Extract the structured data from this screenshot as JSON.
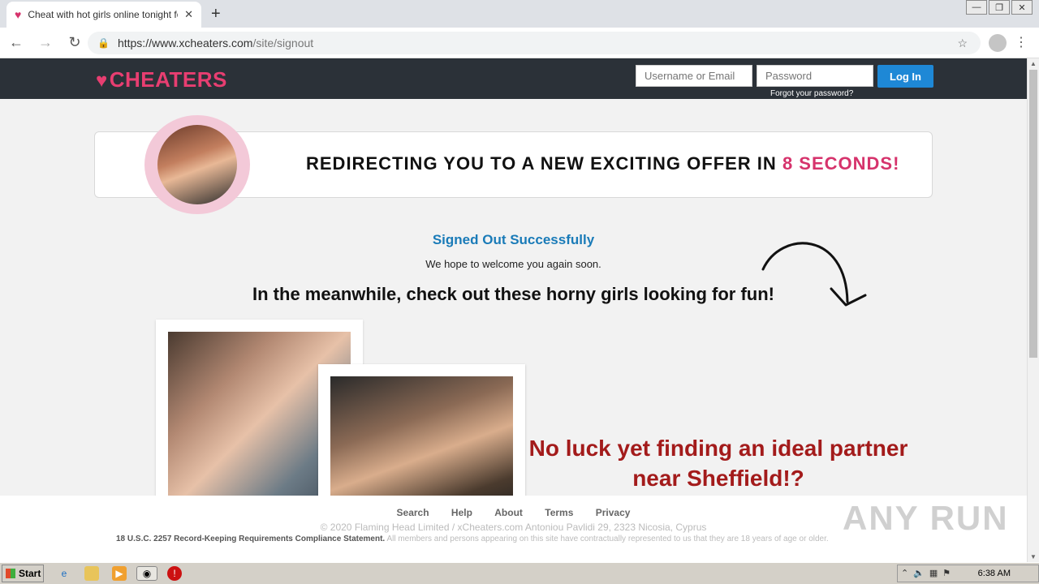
{
  "browser": {
    "tab_title": "Cheat with hot girls online tonight fo",
    "url_domain": "https://www.xcheaters.com",
    "url_path": "/site/signout"
  },
  "header": {
    "logo": "CHEATERS",
    "username_placeholder": "Username or Email",
    "password_placeholder": "Password",
    "login_label": "Log In",
    "forgot_label": "Forgot your password?"
  },
  "banner": {
    "text_prefix": "REDIRECTING YOU TO A NEW EXCITING OFFER IN",
    "countdown": "8 SECONDS!"
  },
  "main": {
    "signed_out_title": "Signed Out Successfully",
    "signed_out_sub": "We hope to welcome you again soon.",
    "meanwhile": "In the meanwhile, check out these horny girls looking for fun!",
    "no_luck": "No luck yet finding an ideal partner near Sheffield!?"
  },
  "footer": {
    "links": [
      "Search",
      "Help",
      "About",
      "Terms",
      "Privacy"
    ],
    "copyright": "© 2020 Flaming Head Limited / xCheaters.com Antoniou Pavlidi 29, 2323 Nicosia, Cyprus",
    "compliance_bold": "18 U.S.C. 2257 Record-Keeping Requirements Compliance Statement.",
    "compliance_rest": "All members and persons appearing on this site have contractually represented to us that they are 18 years of age or older.",
    "watermark": "ANY RUN"
  },
  "taskbar": {
    "start_label": "Start",
    "clock": "6:38 AM"
  },
  "colors": {
    "accent_pink": "#e83e71",
    "header_bg": "#2b3138",
    "login_blue": "#1e88d6",
    "title_blue": "#1a7bb8",
    "noluck_red": "#a31b1b"
  }
}
